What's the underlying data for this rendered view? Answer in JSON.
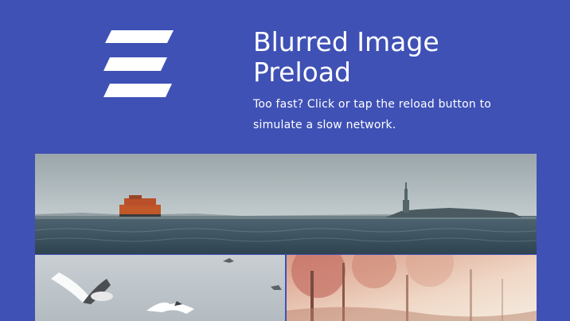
{
  "header": {
    "logo_icon": "stacked-slanted-bars-logo",
    "title": "Blurred Image Preload",
    "description": "Too fast? Click or tap the reload button to simulate a slow network."
  },
  "gallery": {
    "images": [
      {
        "name": "harbor-ferry-statue-photo"
      },
      {
        "name": "seagulls-in-flight-photo"
      },
      {
        "name": "autumn-forest-photo"
      }
    ]
  },
  "colors": {
    "background": "#3f51b5",
    "text": "#ffffff"
  }
}
